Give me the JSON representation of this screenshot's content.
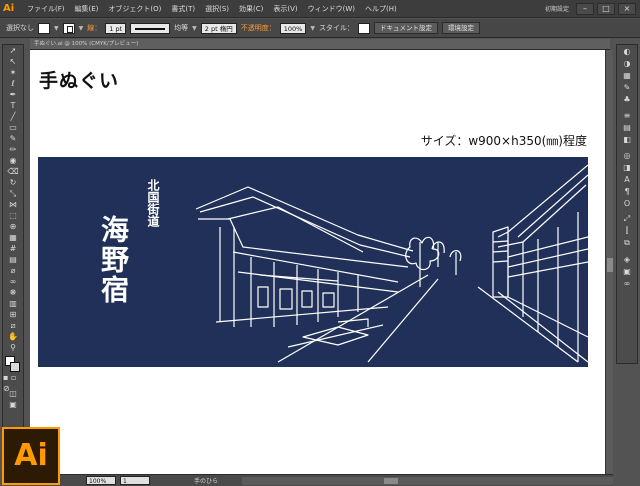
{
  "app": {
    "logo": "Ai",
    "menu": [
      "ファイル(F)",
      "編集(E)",
      "オブジェクト(O)",
      "書式(T)",
      "選択(S)",
      "効果(C)",
      "表示(V)",
      "ウィンドウ(W)",
      "ヘルプ(H)"
    ],
    "workspace": "初期設定"
  },
  "control": {
    "selection_label": "選択なし",
    "stroke_label": "線：",
    "stroke_weight": "1 pt",
    "stroke_profile": "均等",
    "brush": "2 pt 楕円",
    "opacity_label": "不透明度：",
    "opacity": "100%",
    "style_label": "スタイル：",
    "doc_setup_button": "ドキュメント設定",
    "prefs_button": "環境設定"
  },
  "document": {
    "tab": "手ぬぐい.ai @ 100% (CMYK/プレビュー)"
  },
  "artboard": {
    "title": "手ぬぐい",
    "size_note": "サイズ：w900×h350(㎜)程度",
    "towel": {
      "small_text": "北国街道",
      "large_text": "海野宿",
      "color": "#213058"
    }
  },
  "status": {
    "zoom": "100%",
    "page": "1",
    "tool_name": "手のひら"
  },
  "brand": {
    "accent": "#ff9a00",
    "big_logo": "Ai"
  }
}
